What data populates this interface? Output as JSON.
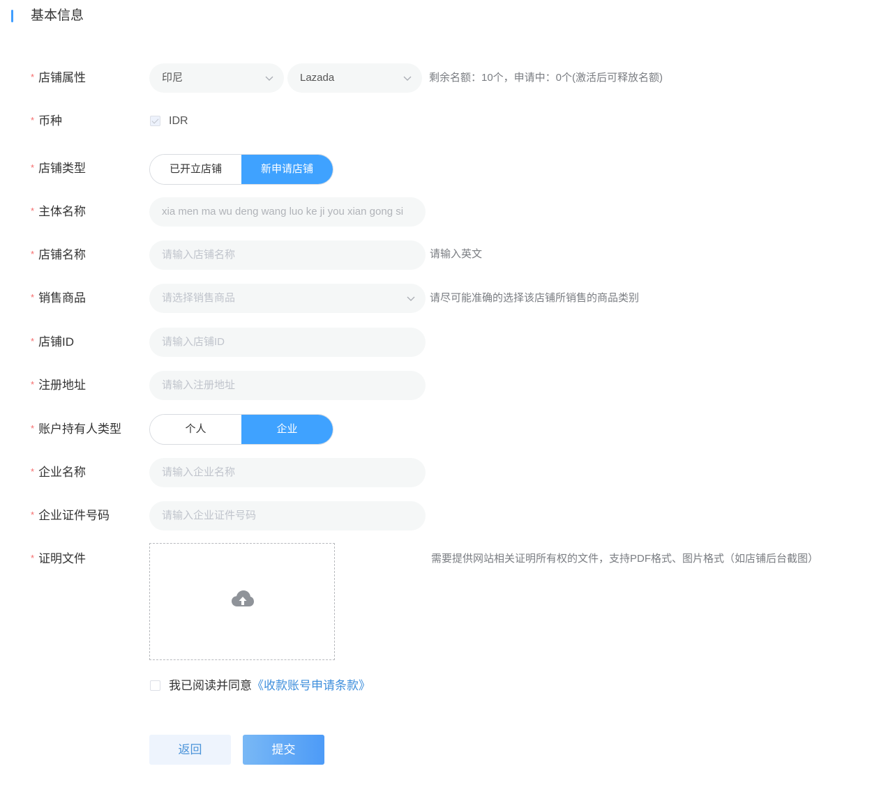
{
  "section": {
    "title": "基本信息"
  },
  "required_mark": "*",
  "labels": {
    "shop_attr": "店铺属性",
    "currency": "币种",
    "shop_type": "店铺类型",
    "entity_name": "主体名称",
    "shop_name": "店铺名称",
    "goods": "销售商品",
    "shop_id": "店铺ID",
    "reg_address": "注册地址",
    "holder_type": "账户持有人类型",
    "company_name": "企业名称",
    "company_cert": "企业证件号码",
    "proof_file": "证明文件"
  },
  "shop_attr": {
    "country": "印尼",
    "platform": "Lazada",
    "hint": "剩余名额：10个，申请中：0个(激活后可释放名额)"
  },
  "currency": {
    "value": "IDR",
    "checked": true,
    "disabled": true
  },
  "shop_type": {
    "options": [
      "已开立店铺",
      "新申请店铺"
    ],
    "selected": "新申请店铺"
  },
  "entity_name": {
    "value": "xia men ma wu deng wang luo ke ji you xian gong si"
  },
  "shop_name": {
    "placeholder": "请输入店铺名称",
    "hint": "请输入英文"
  },
  "goods": {
    "placeholder": "请选择销售商品",
    "hint": "请尽可能准确的选择该店铺所销售的商品类别"
  },
  "shop_id": {
    "placeholder": "请输入店铺ID"
  },
  "reg_address": {
    "placeholder": "请输入注册地址"
  },
  "holder_type": {
    "options": [
      "个人",
      "企业"
    ],
    "selected": "企业"
  },
  "company_name": {
    "placeholder": "请输入企业名称"
  },
  "company_cert": {
    "placeholder": "请输入企业证件号码"
  },
  "proof_file": {
    "icon": "cloud-upload-icon",
    "hint": "需要提供网站相关证明所有权的文件，支持PDF格式、图片格式（如店铺后台截图）"
  },
  "agreement": {
    "text": "我已阅读并同意",
    "link": "《收款账号申请条款》",
    "checked": false
  },
  "buttons": {
    "back": "返回",
    "submit": "提交"
  },
  "colors": {
    "accent": "#3fa2ff",
    "required": "#f56c6c",
    "link": "#3f8fdc"
  }
}
